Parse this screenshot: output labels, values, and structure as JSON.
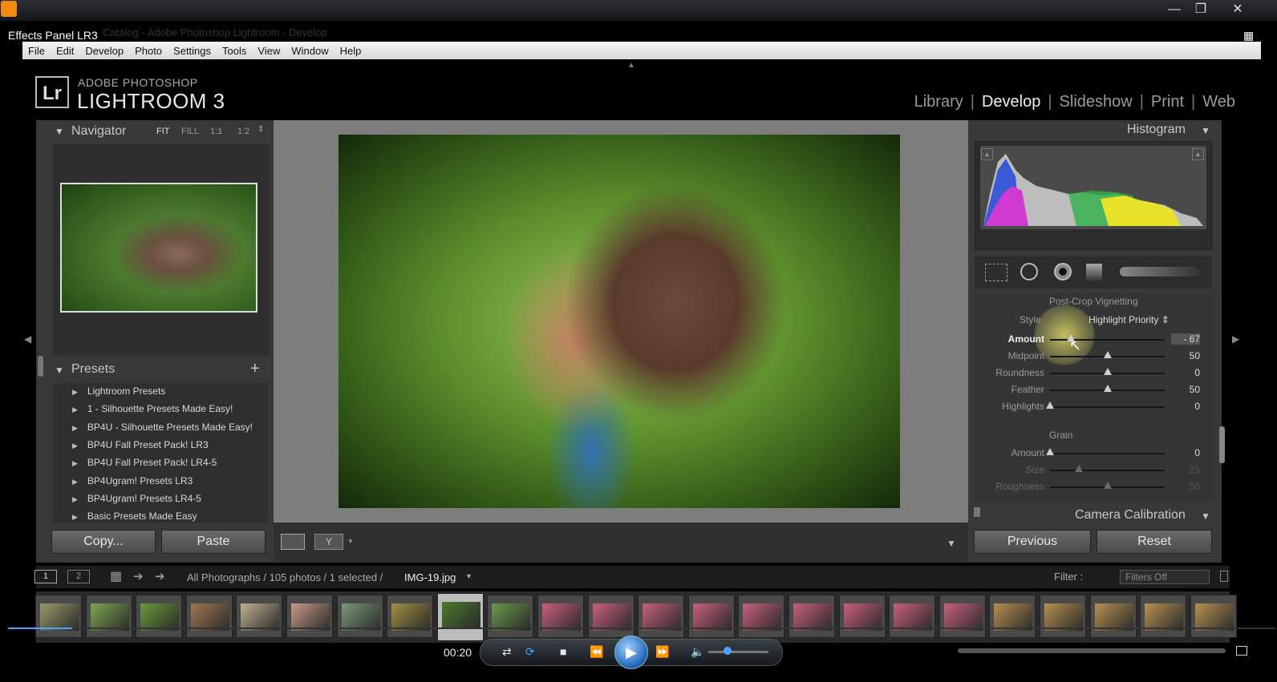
{
  "player": {
    "title": "Effects Panel LR3",
    "time": "00:20",
    "controls": {
      "shuffle_icon": "shuffle-icon",
      "repeat_icon": "repeat-icon",
      "stop_icon": "stop-icon",
      "prev_icon": "rewind-icon",
      "play_icon": "play-icon",
      "next_icon": "fast-forward-icon",
      "volume_icon": "volume-icon"
    },
    "volume_level": 0.28
  },
  "menu": [
    "File",
    "Edit",
    "Develop",
    "Photo",
    "Settings",
    "Tools",
    "View",
    "Window",
    "Help"
  ],
  "window_title_faint": "Catalog - Adobe Photoshop Lightroom - Develop",
  "logo": {
    "mark": "Lr",
    "adobe": "ADOBE PHOTOSHOP",
    "name": "LIGHTROOM 3"
  },
  "modules": [
    "Library",
    "Develop",
    "Slideshow",
    "Print",
    "Web"
  ],
  "active_module": "Develop",
  "navigator": {
    "title": "Navigator",
    "options": [
      "FIT",
      "FILL",
      "1:1",
      "1:2"
    ]
  },
  "presets": {
    "title": "Presets",
    "add": "+",
    "items": [
      "Lightroom Presets",
      "1 - Silhouette Presets Made Easy!",
      "BP4U - Silhouette Presets Made Easy!",
      "BP4U Fall Preset Pack! LR3",
      "BP4U Fall Preset Pack! LR4-5",
      "BP4Ugram! Presets LR3",
      "BP4Ugram! Presets LR4-5",
      "Basic Presets Made Easy"
    ]
  },
  "left_buttons": {
    "copy": "Copy...",
    "paste": "Paste"
  },
  "histogram": {
    "title": "Histogram"
  },
  "vignetting": {
    "title": "Post-Crop Vignetting",
    "style_label": "Style",
    "style_value": "Highlight Priority",
    "rows": [
      {
        "label": "Amount",
        "value": "- 67",
        "pos": 0.18
      },
      {
        "label": "Midpoint",
        "value": "50",
        "pos": 0.5
      },
      {
        "label": "Roundness",
        "value": "0",
        "pos": 0.5
      },
      {
        "label": "Feather",
        "value": "50",
        "pos": 0.5
      },
      {
        "label": "Highlights",
        "value": "0",
        "pos": 0.0
      }
    ]
  },
  "grain": {
    "title": "Grain",
    "rows": [
      {
        "label": "Amount",
        "value": "0",
        "pos": 0.0
      },
      {
        "label": "Size",
        "value": "25",
        "pos": 0.25
      },
      {
        "label": "Roughness",
        "value": "50",
        "pos": 0.5
      }
    ]
  },
  "camera_calibration": "Camera Calibration",
  "right_buttons": {
    "previous": "Previous",
    "reset": "Reset"
  },
  "filmstrip": {
    "pages": [
      "1",
      "2"
    ],
    "path": "All Photographs / 105 photos / 1 selected /",
    "file": "IMG-19.jpg",
    "filter_label": "Filter :",
    "filter_value": "Filters Off"
  },
  "colors": {
    "accent_yellow": "#e8e26a",
    "panel": "#383838",
    "pink_thumb": "#c8607a",
    "tan_thumb": "#b89050",
    "green_thumb": "#6a9a3a"
  }
}
